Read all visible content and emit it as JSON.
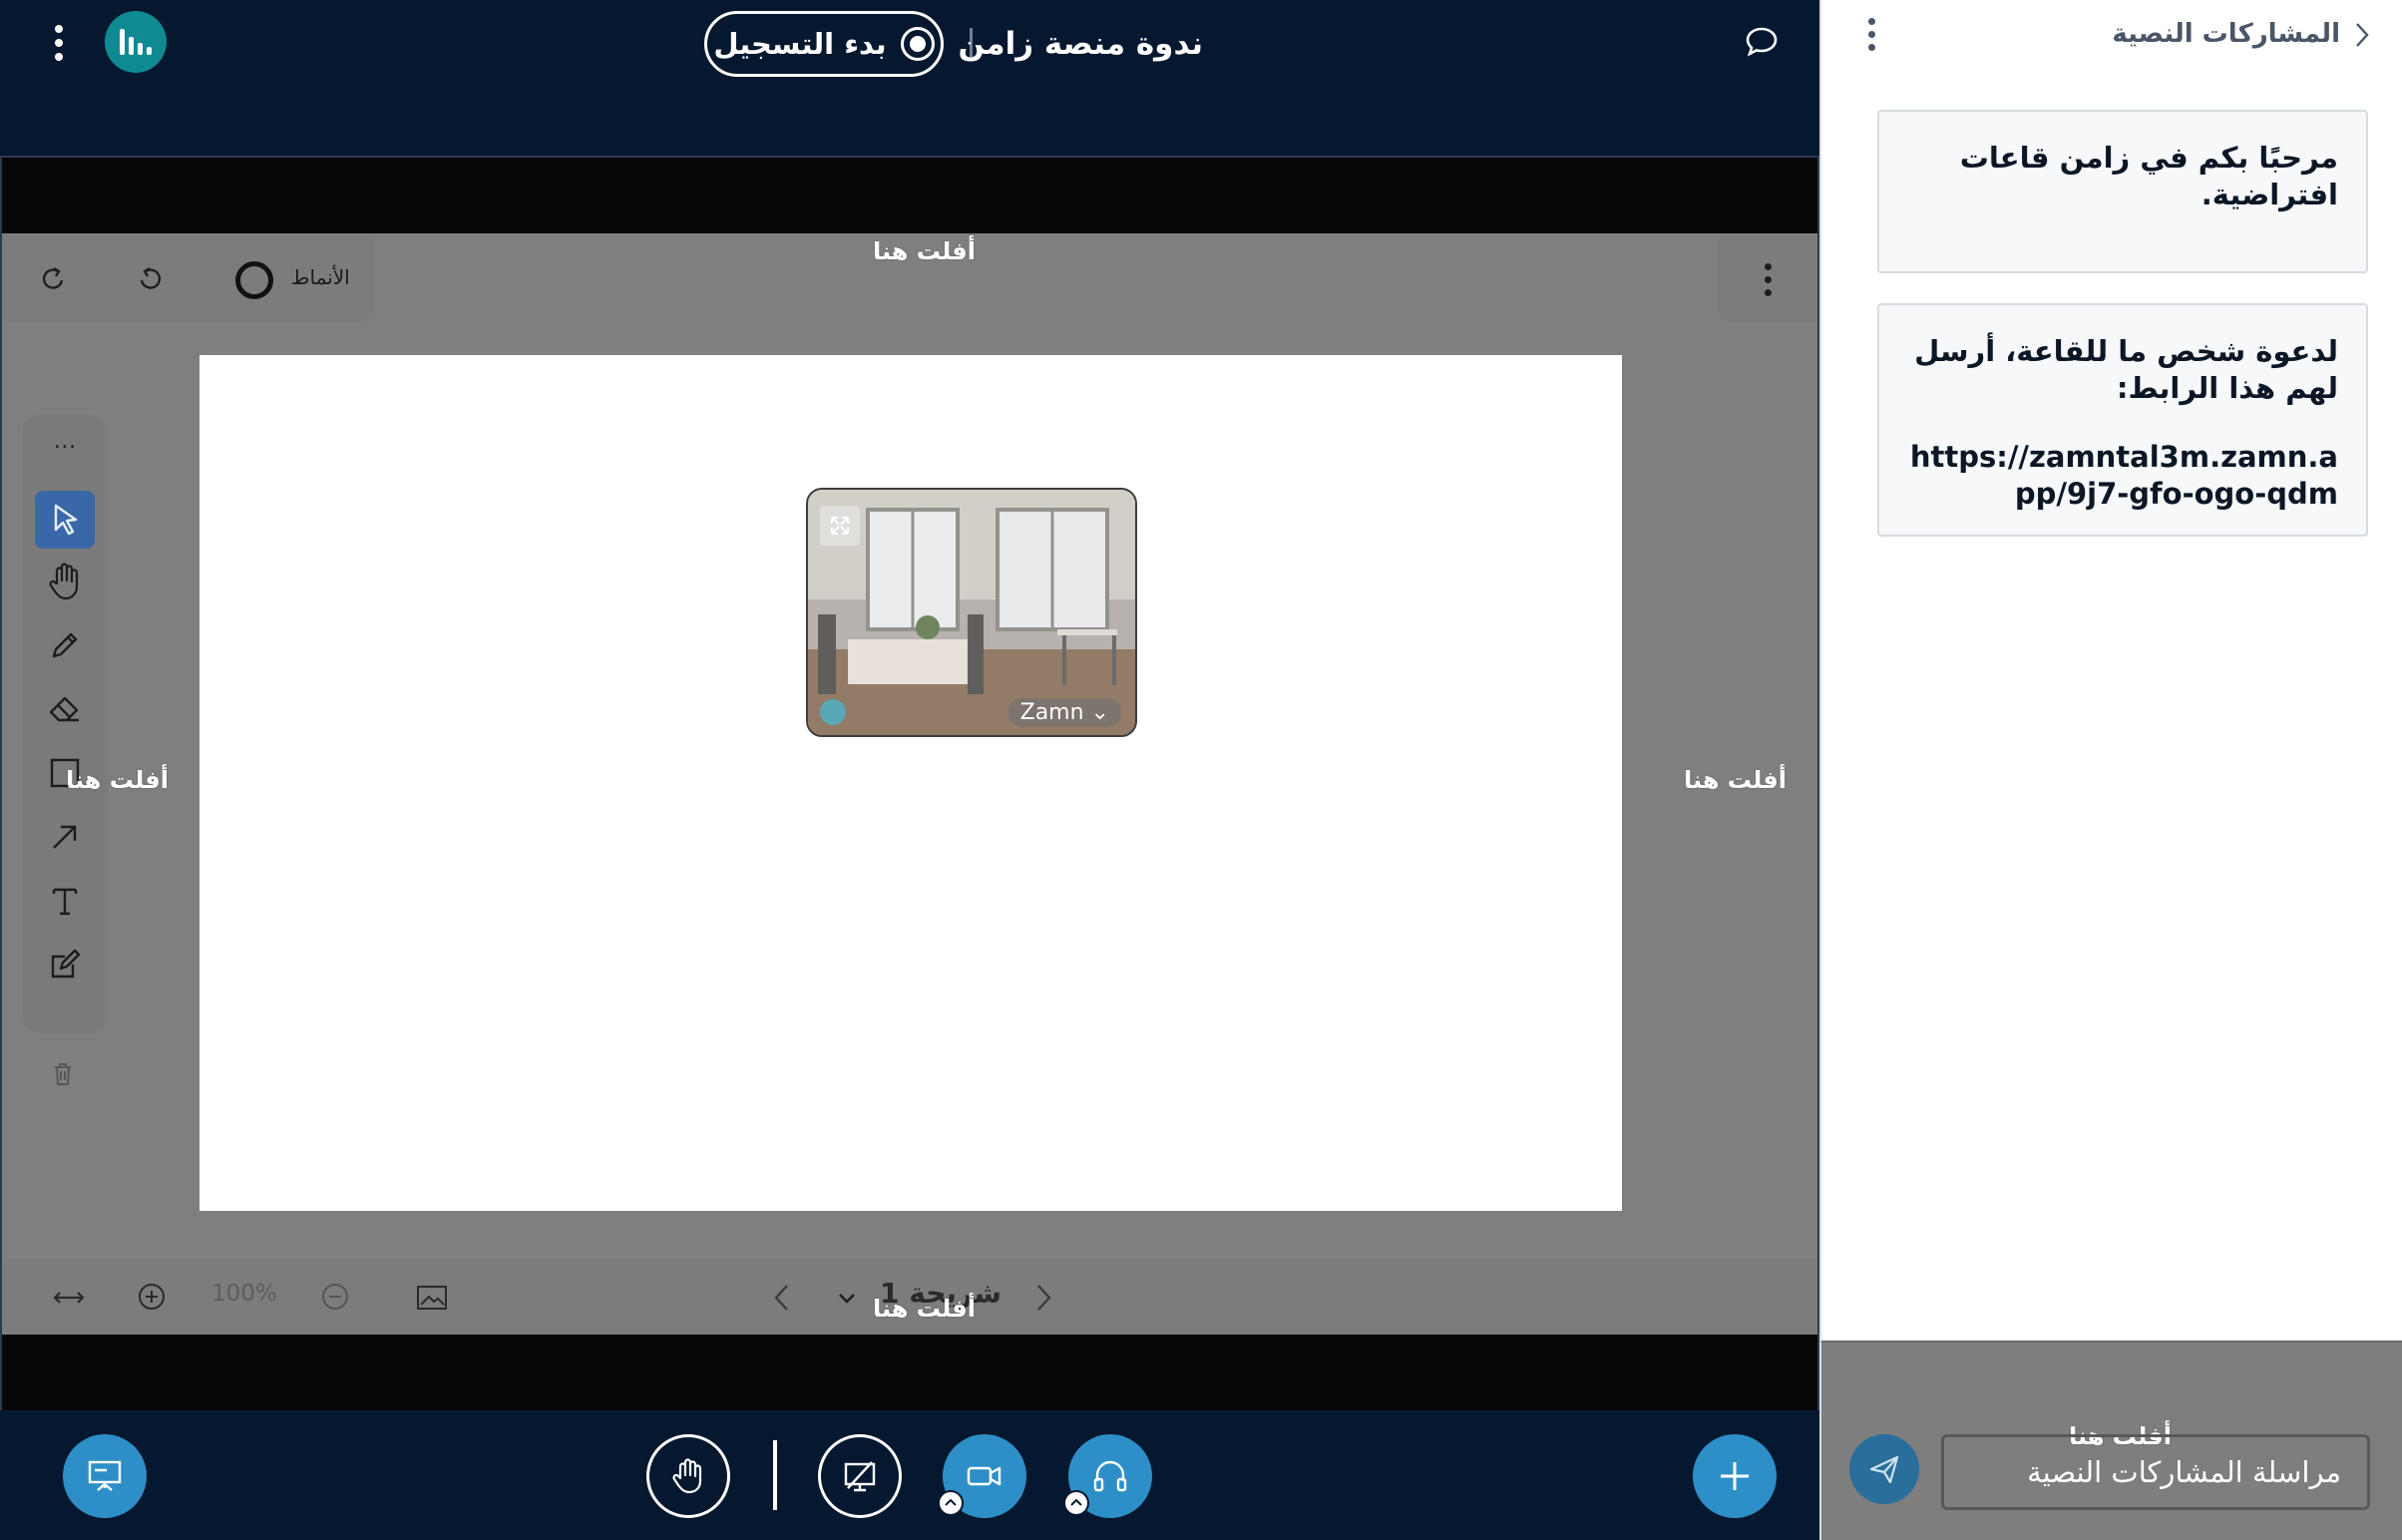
{
  "header": {
    "meeting_title": "ندوة منصة زامن",
    "record_label": "بدء التسجيل",
    "logo_icon": "bar-chart-logo-icon",
    "menu_icon": "kebab-menu-icon",
    "chat_icon": "chat-bubble-icon"
  },
  "stage": {
    "drop_label": "أفلت هنا",
    "styles_label": "الأنماط",
    "zoom_level": "100%",
    "slide_label": "شريحة 1",
    "video": {
      "participant_name": "Zamn"
    }
  },
  "tools": [
    "select",
    "hand",
    "pencil",
    "eraser",
    "rectangle",
    "arrow",
    "text",
    "note",
    "delete"
  ],
  "action_bar": {
    "presentation_icon": "presentation-icon",
    "raise_hand_icon": "raise-hand-icon",
    "screen_share_icon": "screen-share-off-icon",
    "camera_icon": "video-camera-icon",
    "audio_icon": "headphones-icon",
    "add_icon": "plus-icon"
  },
  "side_panel": {
    "title": "المشاركات النصية",
    "welcome_message": "مرحبًا بكم في زامن قاعات افتراضية.",
    "invite_text": "لدعوة شخص ما للقاعة، أرسل لهم هذا الرابط:",
    "invite_link": "https://zamntal3m.zamn.app/9j7-gfo-ogo-qdm",
    "input_placeholder": "مراسلة المشاركات النصية",
    "drop_label": "أفلت هنا"
  },
  "colors": {
    "navy": "#06182f",
    "accent_blue": "#2e8fc8",
    "logo_teal": "#0f8a92",
    "overlay_gray": "#7f7f7f"
  }
}
